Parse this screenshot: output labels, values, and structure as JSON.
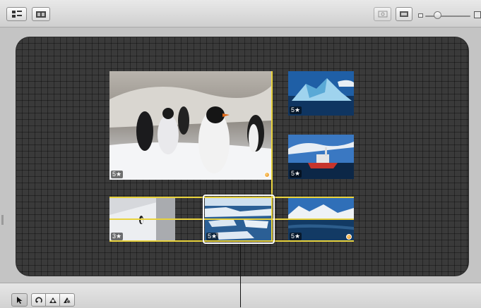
{
  "toolbar_top": {
    "left_buttons": [
      {
        "name": "arrange-icon"
      },
      {
        "name": "photo-browser-icon"
      }
    ],
    "right_buttons": [
      {
        "name": "zoom-to-fit-icon"
      },
      {
        "name": "view-mode-icon"
      }
    ],
    "zoom_level": 0.3
  },
  "canvas": {
    "photos": [
      {
        "id": "penguins",
        "rating": "5★",
        "flagged": true
      },
      {
        "id": "iceberg",
        "rating": "5★",
        "flagged": false
      },
      {
        "id": "ship",
        "rating": "5★",
        "flagged": false
      },
      {
        "id": "lone-penguin",
        "rating": "3★",
        "flagged": false
      },
      {
        "id": "ice-floe",
        "rating": "5★",
        "flagged": false
      },
      {
        "id": "coast",
        "rating": "5★",
        "flagged": true
      }
    ],
    "selected_photo": "ice-floe",
    "guide_color": "#e8d23c"
  },
  "toolbar_bottom": {
    "tools": [
      {
        "name": "pointer-tool-icon",
        "active": true
      },
      {
        "name": "rotate-tool-icon",
        "active": false
      },
      {
        "name": "crop-tool-icon",
        "active": false
      },
      {
        "name": "adjust-tool-icon",
        "active": false
      }
    ]
  }
}
